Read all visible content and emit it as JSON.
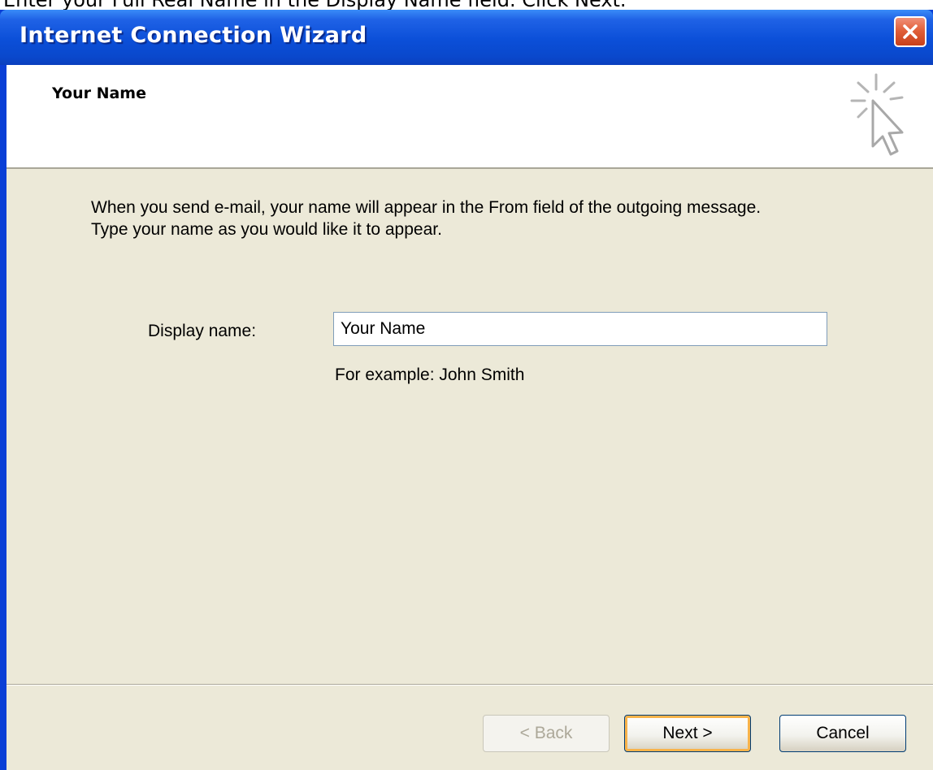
{
  "instruction": "Enter your Full Real Name in the Display Name field.  Click Next.",
  "window": {
    "title": "Internet Connection Wizard",
    "close_icon": "close-icon"
  },
  "header": {
    "title": "Your Name",
    "icon": "cursor-sparkle-icon"
  },
  "body": {
    "description_line1": "When you send e-mail, your name will appear in the From field of the outgoing message.",
    "description_line2": "Type your name as you would like it to appear.",
    "display_name_label": "Display name:",
    "display_name_value": "Your Name",
    "example": "For example: John Smith"
  },
  "buttons": {
    "back": "< Back",
    "next": "Next >",
    "cancel": "Cancel"
  },
  "colors": {
    "titlebar": "#0a4fd8",
    "client": "#ece9d8",
    "close_button": "#e1603a"
  }
}
